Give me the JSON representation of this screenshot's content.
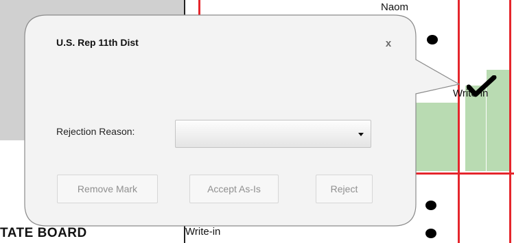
{
  "ballot": {
    "candidate_top": "Naom",
    "write_in_right": "Write-in",
    "write_in_bottom": "Write-in",
    "board_heading": "TATE BOARD"
  },
  "popup": {
    "title": "U.S. Rep 11th Dist",
    "close_label": "x",
    "rejection_label": "Rejection Reason:",
    "rejection_value": "",
    "buttons": {
      "remove_mark": "Remove Mark",
      "accept_as_is": "Accept As-Is",
      "reject": "Reject"
    }
  },
  "icons": {
    "close": "close-icon",
    "dropdown": "chevron-down-icon",
    "checkmark": "checkmark-icon"
  },
  "colors": {
    "red_line": "#e5262c",
    "green_region": "#b9dbb2",
    "popup_bg": "#f3f3f3"
  }
}
